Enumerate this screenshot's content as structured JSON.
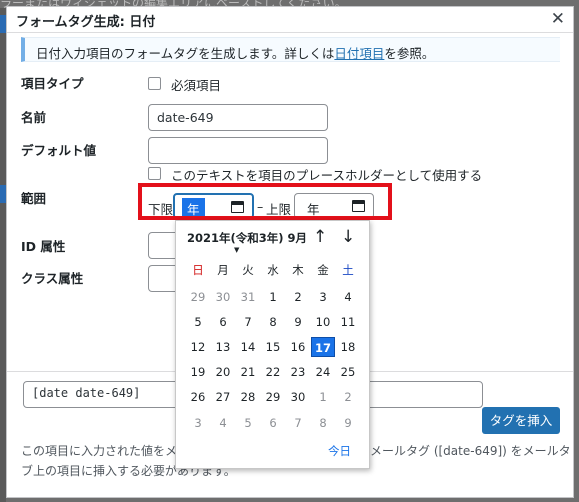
{
  "background": {
    "text": "ラーまたはウィジェットの編集エリアにペーストしてください。"
  },
  "dialog": {
    "title": "フォームタグ生成: 日付",
    "close_icon": "close-icon",
    "notice_text": "日付入力項目のフォームタグを生成します。詳しくは",
    "notice_link": "日付項目",
    "notice_suffix": "を参照。"
  },
  "fields": {
    "type_label": "項目タイプ",
    "required_label": "必須項目",
    "name_label": "名前",
    "name_value": "date-649",
    "default_label": "デフォルト値",
    "default_value": "",
    "placeholder_label": "このテキストを項目のプレースホルダーとして使用する",
    "range_label": "範囲",
    "range_min_label": "下限",
    "range_min_value": "年",
    "range_dash": "–",
    "range_max_label": "上限",
    "range_max_value": "年",
    "id_label": "ID 属性",
    "class_label": "クラス属性"
  },
  "calendar": {
    "month_label": "2021年(令和3年) 9月",
    "dropdown_glyph": "▼",
    "prev_glyph": "↑",
    "next_glyph": "↓",
    "weekdays": [
      "日",
      "月",
      "火",
      "水",
      "木",
      "金",
      "土"
    ],
    "weeks": [
      [
        "29",
        "30",
        "31",
        "1",
        "2",
        "3",
        "4"
      ],
      [
        "5",
        "6",
        "7",
        "8",
        "9",
        "10",
        "11"
      ],
      [
        "12",
        "13",
        "14",
        "15",
        "16",
        "17",
        "18"
      ],
      [
        "19",
        "20",
        "21",
        "22",
        "23",
        "24",
        "25"
      ],
      [
        "26",
        "27",
        "28",
        "29",
        "30",
        "1",
        "2"
      ],
      [
        "3",
        "4",
        "5",
        "6",
        "7",
        "8",
        "9"
      ]
    ],
    "selected_day": "17",
    "today_label": "今日"
  },
  "output": {
    "tag_value": "[date date-649]",
    "insert_button": "タグを挿入",
    "footer_line1": "この項目に入力された値をメ",
    "footer_line1_right": "メールタグ ([date-649]) をメールタ",
    "footer_line2": "ブ上の項目に挿入する必要があります。"
  },
  "colors": {
    "accent": "#2271b1",
    "highlight_box": "#e3101a",
    "calendar_selected": "#1a73e8"
  }
}
